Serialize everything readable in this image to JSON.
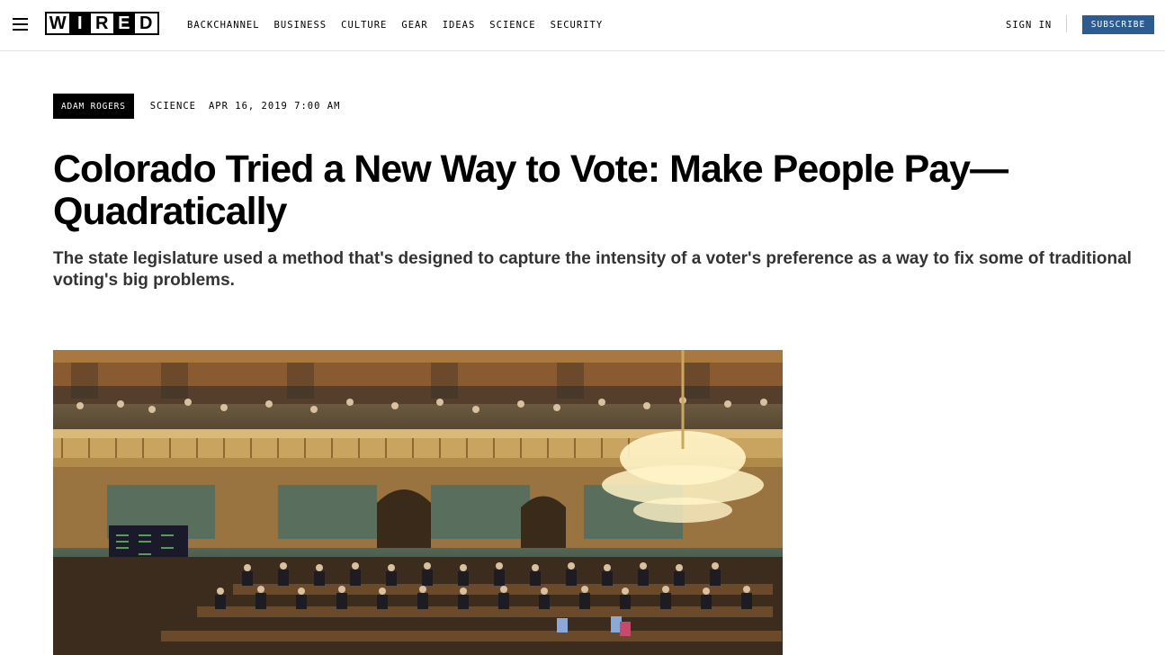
{
  "nav": {
    "logo_letters": [
      "W",
      "I",
      "R",
      "E",
      "D"
    ],
    "links": [
      "BACKCHANNEL",
      "BUSINESS",
      "CULTURE",
      "GEAR",
      "IDEAS",
      "SCIENCE",
      "SECURITY"
    ],
    "sign_in": "SIGN IN",
    "subscribe": "SUBSCRIBE"
  },
  "byline": {
    "author": "ADAM ROGERS",
    "section": "SCIENCE",
    "date": "APR 16, 2019 7:00 AM"
  },
  "article": {
    "title": "Colorado Tried a New Way to Vote: Make People Pay—Quadratically",
    "dek": "The state legislature used a method that's designed to capture the intensity of a voter's preference as a way to fix some of traditional voting's big problems."
  },
  "colors": {
    "subscribe_bg": "#2b5b8f",
    "text": "#000000",
    "dek_text": "#333333"
  }
}
